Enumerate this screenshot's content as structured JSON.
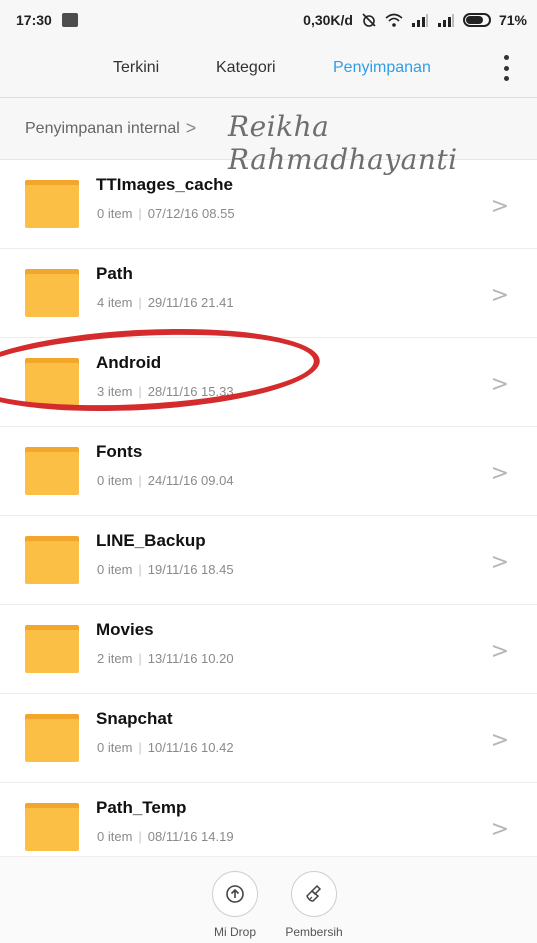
{
  "status_bar": {
    "time": "17:30",
    "net_speed": "0,30K/d",
    "battery": "71%",
    "icons": [
      "notification-icon",
      "alarm-off-icon",
      "wifi-icon",
      "signal-icon",
      "signal-icon",
      "battery-icon"
    ]
  },
  "tabs": [
    {
      "label": "Terkini"
    },
    {
      "label": "Kategori"
    },
    {
      "label": "Penyimpanan"
    }
  ],
  "breadcrumb": {
    "label": "Penyimpanan internal",
    "separator": ">"
  },
  "signature": "Reikha Rahmadhayanti",
  "folders": [
    {
      "name": "TTImages_cache",
      "count": "0 item",
      "date": "07/12/16 08.55"
    },
    {
      "name": "Path",
      "count": "4 item",
      "date": "29/11/16 21.41"
    },
    {
      "name": "Android",
      "count": "3 item",
      "date": "28/11/16 15.33"
    },
    {
      "name": "Fonts",
      "count": "0 item",
      "date": "24/11/16 09.04"
    },
    {
      "name": "LINE_Backup",
      "count": "0 item",
      "date": "19/11/16 18.45"
    },
    {
      "name": "Movies",
      "count": "2 item",
      "date": "13/11/16 10.20"
    },
    {
      "name": "Snapchat",
      "count": "0 item",
      "date": "10/11/16 10.42"
    },
    {
      "name": "Path_Temp",
      "count": "0 item",
      "date": "08/11/16 14.19"
    }
  ],
  "meta_separator": "|",
  "chevron": ">",
  "bottom_bar": {
    "mi_drop": "Mi Drop",
    "cleaner": "Pembersih"
  },
  "colors": {
    "accent": "#2e9fe6",
    "folder": "#fbbf45",
    "annotation": "#d42c2c"
  }
}
